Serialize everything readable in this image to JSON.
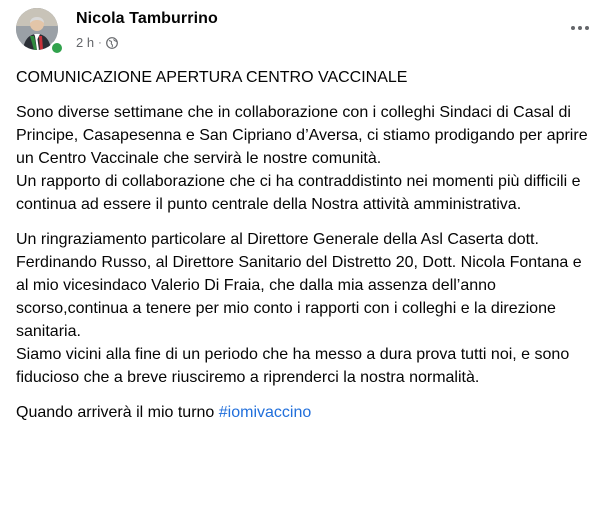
{
  "post": {
    "author_name": "Nicola Tamburrino",
    "timestamp": "2 h",
    "separator": "·",
    "privacy_icon": "globe-icon",
    "more_icon": "more-options-icon",
    "paragraphs": [
      "COMUNICAZIONE APERTURA CENTRO VACCINALE",
      "Sono diverse settimane che in collaborazione con i colleghi Sindaci di Casal di Principe, Casapesenna e San Cipriano d’Aversa, ci stiamo prodigando per aprire un Centro Vaccinale che servirà le nostre comunità.\nUn rapporto di collaborazione che ci ha contraddistinto nei momenti più difficili e continua ad essere il punto centrale della Nostra attività amministrativa.",
      "Un ringraziamento particolare al Direttore Generale della Asl Caserta dott. Ferdinando Russo, al Direttore Sanitario del Distretto 20, Dott. Nicola Fontana e al mio vicesindaco Valerio Di Fraia, che dalla mia assenza dell’anno scorso,continua a tenere per mio conto i rapporti con i colleghi e la direzione sanitaria.\nSiamo vicini alla fine di un periodo che ha messo a dura prova tutti noi, e sono fiducioso che a breve riusciremo a riprenderci la nostra normalità."
    ],
    "closing_text": "Quando arriverà il mio turno ",
    "hashtag": "#iomivaccino"
  },
  "colors": {
    "online": "#31a24c",
    "hashtag": "#216fdb",
    "meta": "#65676b"
  }
}
